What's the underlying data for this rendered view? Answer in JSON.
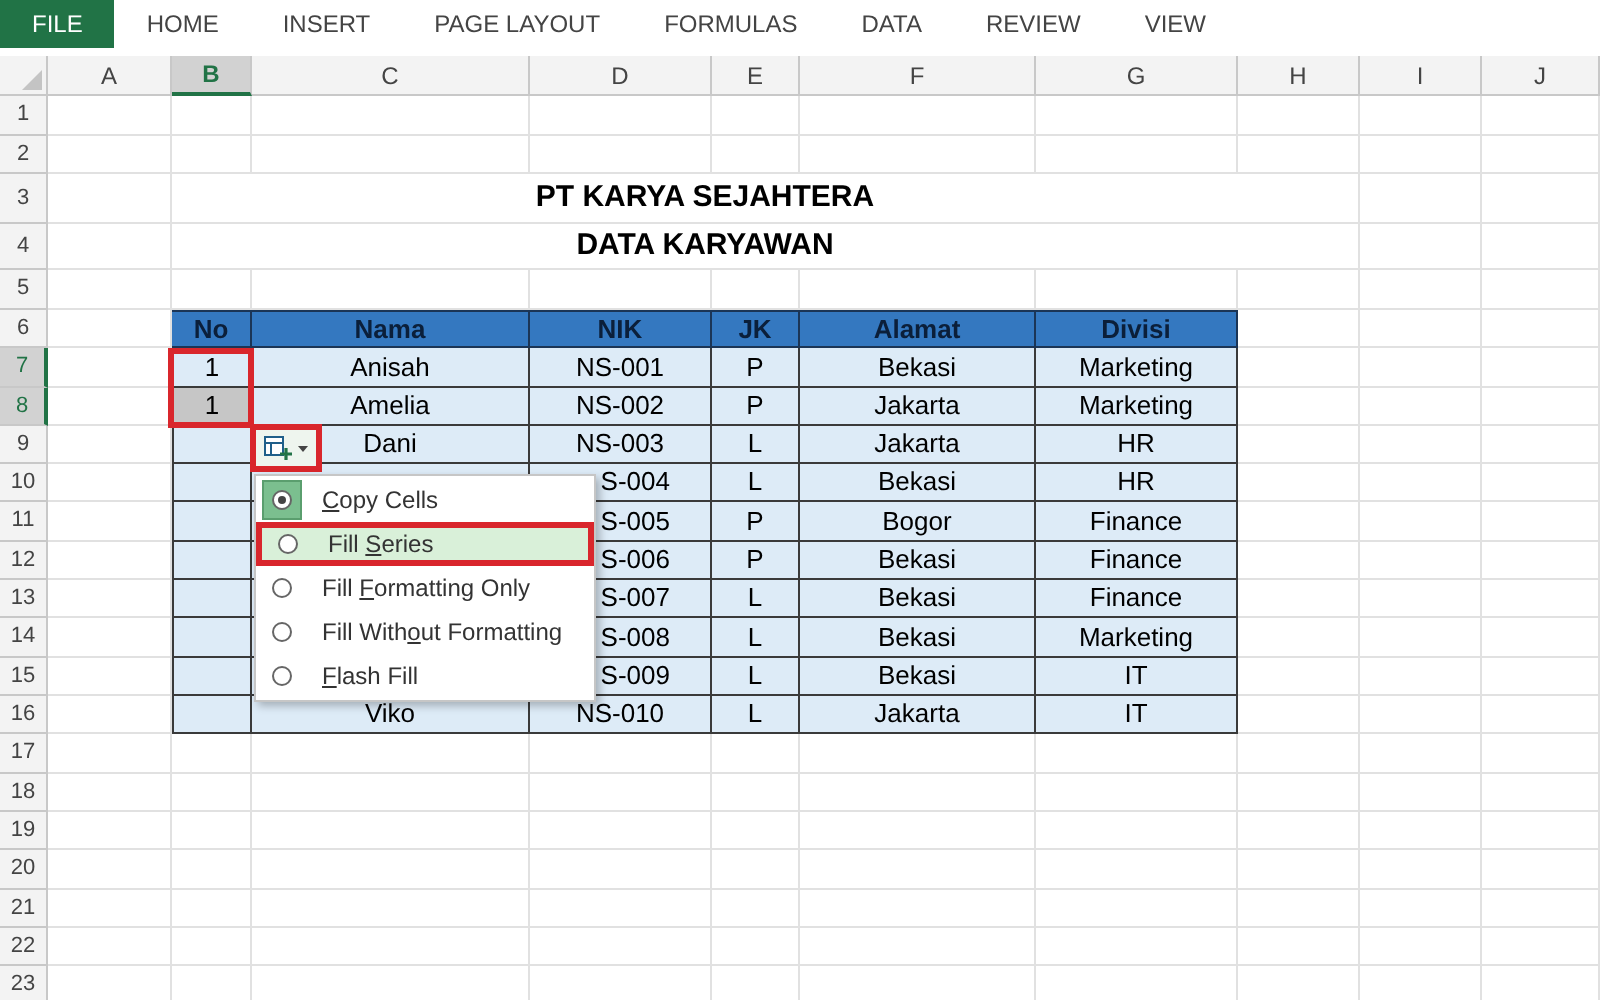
{
  "ribbon": {
    "tabs": [
      {
        "label": "FILE",
        "selected": true
      },
      {
        "label": "HOME",
        "selected": false
      },
      {
        "label": "INSERT",
        "selected": false
      },
      {
        "label": "PAGE LAYOUT",
        "selected": false
      },
      {
        "label": "FORMULAS",
        "selected": false
      },
      {
        "label": "DATA",
        "selected": false
      },
      {
        "label": "REVIEW",
        "selected": false
      },
      {
        "label": "VIEW",
        "selected": false
      }
    ]
  },
  "sheet": {
    "columns": [
      {
        "label": "A",
        "selected": false
      },
      {
        "label": "B",
        "selected": true
      },
      {
        "label": "C",
        "selected": false
      },
      {
        "label": "D",
        "selected": false
      },
      {
        "label": "E",
        "selected": false
      },
      {
        "label": "F",
        "selected": false
      },
      {
        "label": "G",
        "selected": false
      },
      {
        "label": "H",
        "selected": false
      },
      {
        "label": "I",
        "selected": false
      },
      {
        "label": "J",
        "selected": false
      }
    ],
    "rows": [
      {
        "number": "1",
        "selected": false
      },
      {
        "number": "2",
        "selected": false
      },
      {
        "number": "3",
        "selected": false
      },
      {
        "number": "4",
        "selected": false
      },
      {
        "number": "5",
        "selected": false
      },
      {
        "number": "6",
        "selected": false
      },
      {
        "number": "7",
        "selected": true
      },
      {
        "number": "8",
        "selected": true
      },
      {
        "number": "9",
        "selected": false
      },
      {
        "number": "10",
        "selected": false
      },
      {
        "number": "11",
        "selected": false
      },
      {
        "number": "12",
        "selected": false
      },
      {
        "number": "13",
        "selected": false
      },
      {
        "number": "14",
        "selected": false
      },
      {
        "number": "15",
        "selected": false
      },
      {
        "number": "16",
        "selected": false
      },
      {
        "number": "17",
        "selected": false
      },
      {
        "number": "18",
        "selected": false
      },
      {
        "number": "19",
        "selected": false
      },
      {
        "number": "20",
        "selected": false
      },
      {
        "number": "21",
        "selected": false
      },
      {
        "number": "22",
        "selected": false
      },
      {
        "number": "23",
        "selected": false
      }
    ]
  },
  "table": {
    "title_lines": [
      "PT KARYA SEJAHTERA",
      "DATA KARYAWAN"
    ],
    "headers": [
      "No",
      "Nama",
      "NIK",
      "JK",
      "Alamat",
      "Divisi"
    ],
    "rows": [
      {
        "no": "1",
        "selected": false,
        "nama": "Anisah",
        "nik": "NS-001",
        "jk": "P",
        "alamat": "Bekasi",
        "divisi": "Marketing"
      },
      {
        "no": "1",
        "selected": true,
        "nama": "Amelia",
        "nik": "NS-002",
        "jk": "P",
        "alamat": "Jakarta",
        "divisi": "Marketing"
      },
      {
        "selected": false,
        "nama": "Dani",
        "nik": "NS-003",
        "jk": "L",
        "alamat": "Jakarta",
        "divisi": "HR"
      },
      {
        "selected": false,
        "nik": "S-004",
        "jk": "L",
        "alamat": "Bekasi",
        "divisi": "HR"
      },
      {
        "selected": false,
        "nik": "S-005",
        "jk": "P",
        "alamat": "Bogor",
        "divisi": "Finance"
      },
      {
        "selected": false,
        "nik": "S-006",
        "jk": "P",
        "alamat": "Bekasi",
        "divisi": "Finance"
      },
      {
        "selected": false,
        "nik": "S-007",
        "jk": "L",
        "alamat": "Bekasi",
        "divisi": "Finance"
      },
      {
        "selected": false,
        "nik": "S-008",
        "jk": "L",
        "alamat": "Bekasi",
        "divisi": "Marketing"
      },
      {
        "selected": false,
        "nik": "S-009",
        "jk": "L",
        "alamat": "Bekasi",
        "divisi": "IT"
      },
      {
        "selected": false,
        "nama": "Viko",
        "nik": "NS-010",
        "jk": "L",
        "alamat": "Jakarta",
        "divisi": "IT"
      }
    ],
    "no_annotated": true
  },
  "paste_options": {
    "annotated": true,
    "menu": [
      {
        "label_parts": {
          "key": "C",
          "after": "opy Cells"
        },
        "selected": true,
        "hover": false,
        "annotated": false
      },
      {
        "label_parts": {
          "before": "Fill ",
          "key": "S",
          "after": "eries"
        },
        "selected": false,
        "hover": true,
        "annotated": true
      },
      {
        "label_parts": {
          "before": "Fill ",
          "key": "F",
          "after": "ormatting Only"
        },
        "selected": false,
        "hover": false,
        "annotated": false
      },
      {
        "label_parts": {
          "before": "Fill With",
          "key": "o",
          "after": "ut Formatting"
        },
        "selected": false,
        "hover": false,
        "annotated": false
      },
      {
        "label_parts": {
          "key": "F",
          "after": "lash Fill"
        },
        "selected": false,
        "hover": false,
        "annotated": false
      }
    ]
  }
}
